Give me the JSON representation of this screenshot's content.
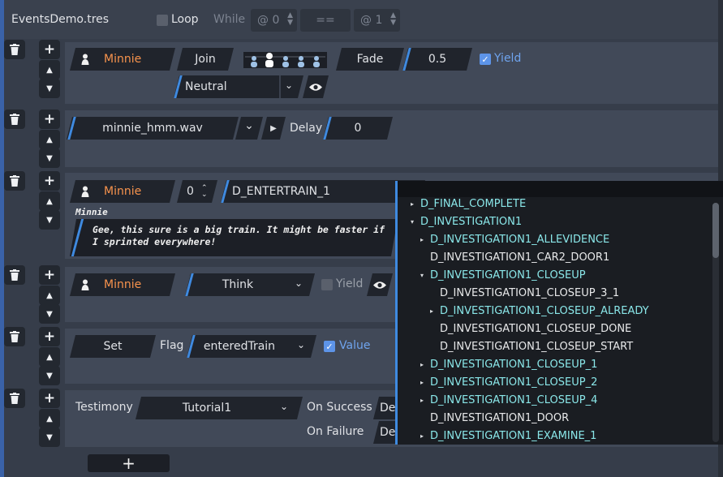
{
  "header": {
    "title": "EventsDemo.tres",
    "loop_label": "Loop",
    "while_label": "While",
    "left_value": "@ 0",
    "operator": "==",
    "right_value": "@ 1"
  },
  "events": {
    "join": {
      "character": "Minnie",
      "action": "Join",
      "transition": "Fade",
      "duration": "0.5",
      "yield_label": "Yield",
      "portrait": "Neutral"
    },
    "sound": {
      "file": "minnie_hmm.wav",
      "delay_label": "Delay",
      "delay_value": "0"
    },
    "dialog": {
      "character": "Minnie",
      "index": "0",
      "dialog_key": "D_ENTERTRAIN_1",
      "speaker": "Minnie",
      "text": "Gee, this sure is a big train. It might be faster if I sprinted everywhere!"
    },
    "think": {
      "character": "Minnie",
      "action": "Think",
      "yield_label": "Yield"
    },
    "flag": {
      "action": "Set",
      "flag_label": "Flag",
      "flag_name": "enteredTrain",
      "value_label": "Value"
    },
    "testimony": {
      "label": "Testimony",
      "name": "Tutorial1",
      "success_label": "On Success",
      "success_value": "Det",
      "failure_label": "On Failure",
      "failure_value": "Det"
    }
  },
  "add_event_label": "+",
  "dropdown": {
    "items": [
      {
        "label": "D_FINAL_COMPLETE",
        "arrow": "▸",
        "color": "teal"
      },
      {
        "label": "D_INVESTIGATION1",
        "arrow": "▾",
        "color": "teal"
      },
      {
        "label": "D_INVESTIGATION1_ALLEVIDENCE",
        "arrow": "▸",
        "color": "teal"
      },
      {
        "label": "D_INVESTIGATION1_CAR2_DOOR1",
        "arrow": "",
        "color": "white"
      },
      {
        "label": "D_INVESTIGATION1_CLOSEUP",
        "arrow": "▾",
        "color": "teal"
      },
      {
        "label": "D_INVESTIGATION1_CLOSEUP_3_1",
        "arrow": "",
        "color": "white"
      },
      {
        "label": "D_INVESTIGATION1_CLOSEUP_ALREADY",
        "arrow": "▸",
        "color": "teal"
      },
      {
        "label": "D_INVESTIGATION1_CLOSEUP_DONE",
        "arrow": "",
        "color": "white"
      },
      {
        "label": "D_INVESTIGATION1_CLOSEUP_START",
        "arrow": "",
        "color": "white"
      },
      {
        "label": "D_INVESTIGATION1_CLOSEUP_1",
        "arrow": "▸",
        "color": "teal"
      },
      {
        "label": "D_INVESTIGATION1_CLOSEUP_2",
        "arrow": "▸",
        "color": "teal"
      },
      {
        "label": "D_INVESTIGATION1_CLOSEUP_4",
        "arrow": "▸",
        "color": "teal"
      },
      {
        "label": "D_INVESTIGATION1_DOOR",
        "arrow": "",
        "color": "white"
      },
      {
        "label": "D_INVESTIGATION1_EXAMINE_1",
        "arrow": "▸",
        "color": "teal"
      }
    ]
  },
  "icons": {
    "delete": "trash-icon",
    "add": "plus-icon",
    "up": "arrow-up-icon",
    "down": "arrow-down-icon"
  },
  "colors": {
    "accent": "#3f8ae0",
    "character": "#f7934d",
    "tree_teal": "#8ae7e9",
    "background": "#363d4a",
    "panel": "#414958"
  }
}
